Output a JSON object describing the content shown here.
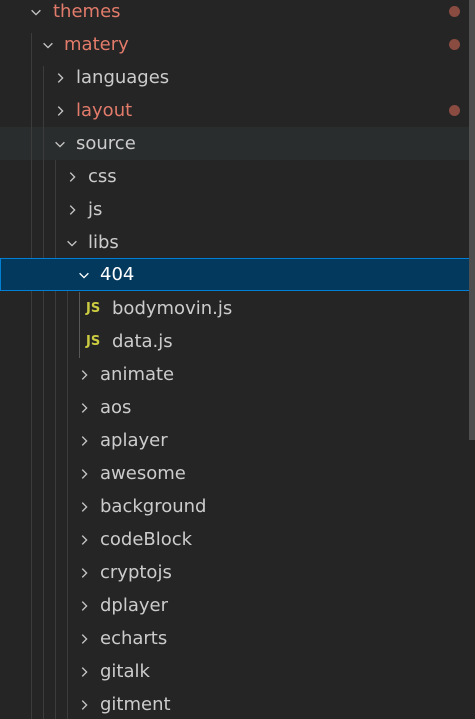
{
  "tree": {
    "themes": {
      "label": "themes",
      "state": "modified"
    },
    "matery": {
      "label": "matery",
      "state": "modified"
    },
    "languages": {
      "label": "languages"
    },
    "layout": {
      "label": "layout",
      "state": "modified"
    },
    "source": {
      "label": "source"
    },
    "css": {
      "label": "css"
    },
    "js": {
      "label": "js"
    },
    "libs": {
      "label": "libs"
    },
    "folder_404": {
      "label": "404",
      "state": "selected"
    },
    "bodymovin": {
      "label": "bodymovin.js",
      "icon_text": "JS"
    },
    "data_js": {
      "label": "data.js",
      "icon_text": "JS"
    },
    "animate": {
      "label": "animate"
    },
    "aos": {
      "label": "aos"
    },
    "aplayer": {
      "label": "aplayer"
    },
    "awesome": {
      "label": "awesome"
    },
    "background": {
      "label": "background"
    },
    "codeBlock": {
      "label": "codeBlock"
    },
    "cryptojs": {
      "label": "cryptojs"
    },
    "dplayer": {
      "label": "dplayer"
    },
    "echarts": {
      "label": "echarts"
    },
    "gitalk": {
      "label": "gitalk"
    },
    "gitment": {
      "label": "gitment"
    }
  },
  "colors": {
    "background": "#252526",
    "text": "#cccccc",
    "modified_text": "#e27b6a",
    "modified_dot": "#8a4b40",
    "selection_bg": "#04395e",
    "selection_border": "#007fd4",
    "js_icon": "#cbcb41"
  }
}
